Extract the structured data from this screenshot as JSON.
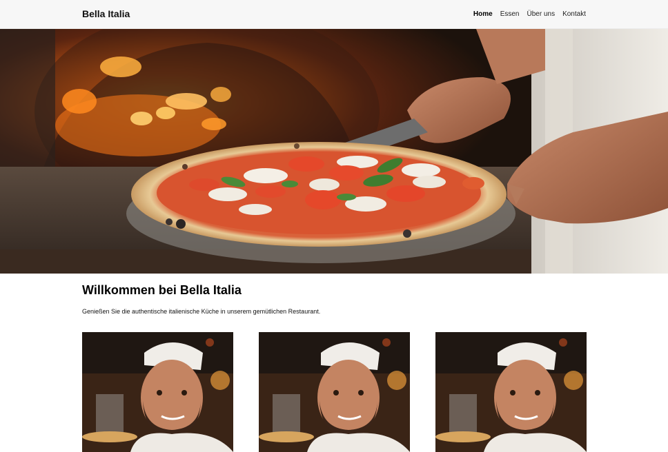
{
  "header": {
    "brand": "Bella Italia",
    "nav": [
      {
        "label": "Home",
        "active": true
      },
      {
        "label": "Essen",
        "active": false
      },
      {
        "label": "Über uns",
        "active": false
      },
      {
        "label": "Kontakt",
        "active": false
      }
    ]
  },
  "main": {
    "title": "Willkommen bei Bella Italia",
    "intro": "Genießen Sie die authentische italienische Küche in unserem gemütlichen Restaurant."
  },
  "colors": {
    "header_bg": "#f7f7f7",
    "text": "#111111",
    "fire": "#ff8a1f",
    "tomato": "#e5482a",
    "basil": "#3f7d2f"
  }
}
